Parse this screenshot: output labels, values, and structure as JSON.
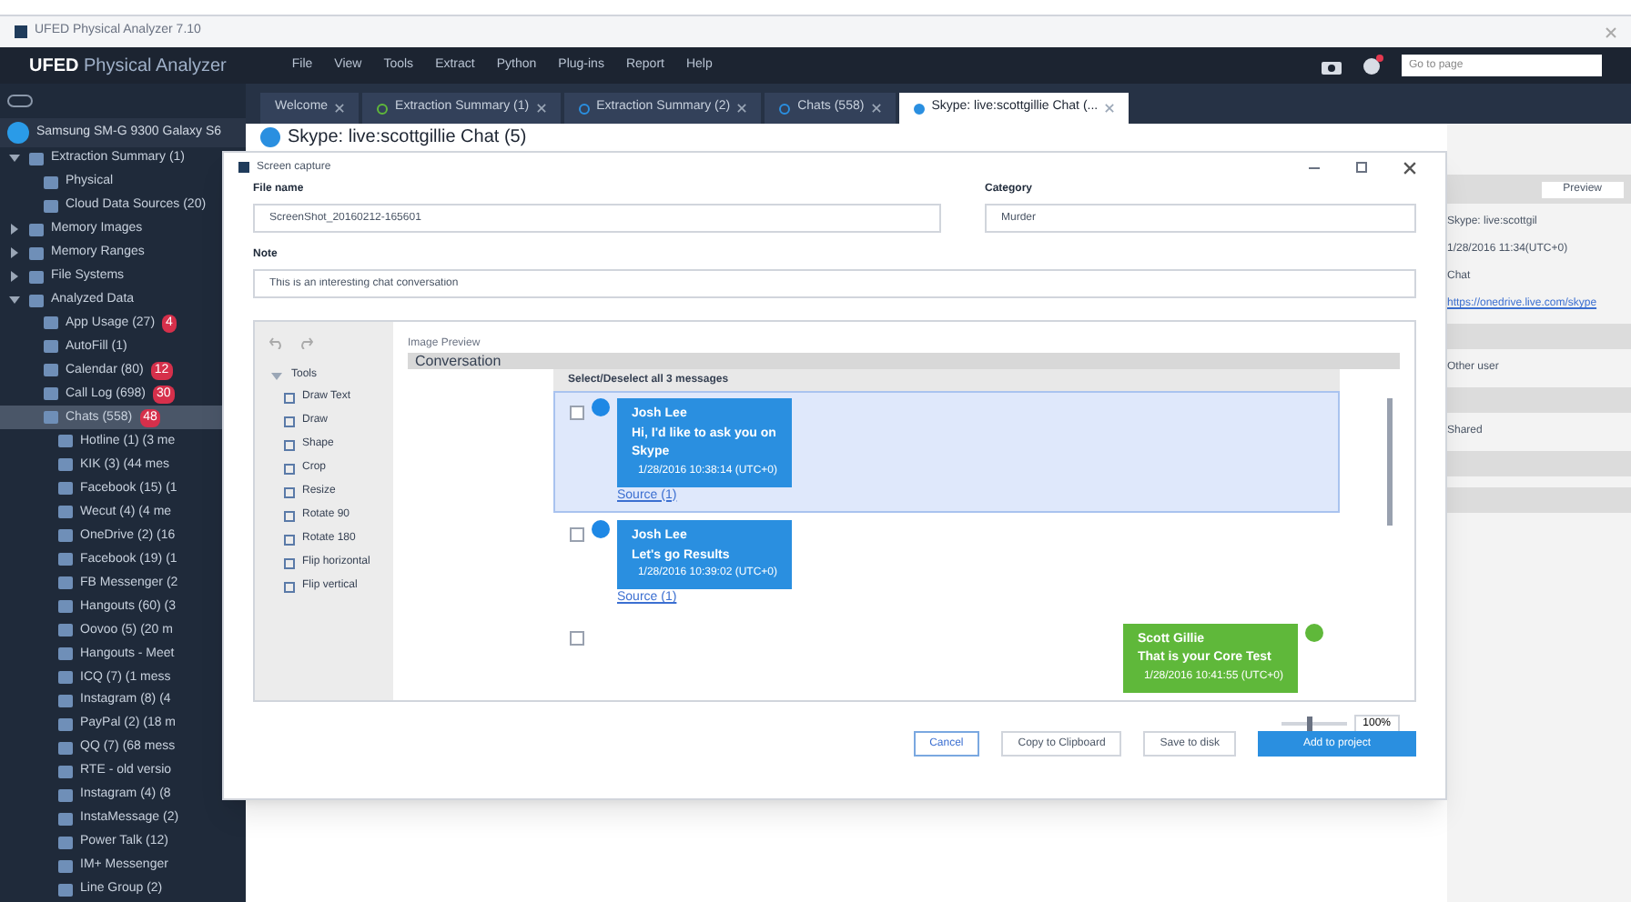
{
  "window": {
    "title": "UFED Physical Analyzer 7.10"
  },
  "app": {
    "brand": "UFED",
    "product": "Physical Analyzer",
    "menu": [
      "File",
      "View",
      "Tools",
      "Extract",
      "Python",
      "Plug-ins",
      "Report",
      "Help"
    ],
    "search": {
      "placeholder": "Go to page"
    }
  },
  "tabs": [
    {
      "label": "Welcome",
      "selected": false,
      "kind": "plain"
    },
    {
      "label": "Extraction Summary (1)",
      "selected": false,
      "kind": "green"
    },
    {
      "label": "Extraction Summary (2)",
      "selected": false,
      "kind": "blue"
    },
    {
      "label": "Chats (558)",
      "selected": false,
      "kind": "blue"
    },
    {
      "label": "Skype: live:scottgillie Chat (...",
      "selected": true,
      "kind": "dot"
    }
  ],
  "sidebar": {
    "device": "Samsung SM-G 9300 Galaxy S6",
    "items": [
      {
        "label": "Extraction Summary (1)",
        "expanded": true,
        "children": [
          {
            "label": "Physical"
          },
          {
            "label": "Cloud Data Sources (20)"
          }
        ]
      },
      {
        "label": "Memory Images",
        "expanded": false
      },
      {
        "label": "Memory Ranges",
        "expanded": false
      },
      {
        "label": "File Systems",
        "expanded": false
      },
      {
        "label": "Analyzed Data",
        "expanded": true,
        "children": [
          {
            "label": "App Usage (27)",
            "badge": "4"
          },
          {
            "label": "AutoFill (1)"
          },
          {
            "label": "Calendar (80)",
            "badge": "12"
          },
          {
            "label": "Call Log (698)",
            "badge": "30"
          },
          {
            "label": "Chats (558)",
            "badge": "48",
            "selected": true,
            "children": [
              {
                "label": "Hotline (1) (3 me"
              },
              {
                "label": "KIK (3) (44 mes"
              },
              {
                "label": "Facebook (15) (1"
              },
              {
                "label": "Wecut (4) (4 me"
              },
              {
                "label": "OneDrive (2) (16"
              },
              {
                "label": "Facebook (19) (1"
              },
              {
                "label": "FB Messenger (2"
              },
              {
                "label": "Hangouts (60) (3"
              },
              {
                "label": "Oovoo (5) (20 m"
              },
              {
                "label": "Hangouts - Meet"
              },
              {
                "label": "ICQ (7) (1 mess"
              },
              {
                "label": "Instagram (8) (4"
              },
              {
                "label": "PayPal (2) (18 m"
              },
              {
                "label": "QQ (7) (68 mess"
              },
              {
                "label": "RTE - old versio"
              },
              {
                "label": "Instagram (4) (8"
              },
              {
                "label": "InstaMessage (2)"
              },
              {
                "label": "Power Talk (12)"
              },
              {
                "label": "IM+ Messenger"
              },
              {
                "label": "Line Group (2)"
              }
            ]
          }
        ]
      }
    ]
  },
  "page": {
    "heading": "Skype: live:scottgillie Chat (5)",
    "side": {
      "button": "Preview",
      "lines": [
        "Skype: live:scottgil",
        "1/28/2016 11:34(UTC+0)",
        "Chat"
      ],
      "link": "https://onedrive.live.com/skype",
      "rows": [
        "Other user",
        "Shared"
      ]
    }
  },
  "dialog": {
    "title": "Screen capture",
    "fields": [
      {
        "label": "File name",
        "value": "ScreenShot_20160212-165601"
      },
      {
        "label": "Category",
        "value": "Murder"
      },
      {
        "label": "Note",
        "value": "This is an interesting chat conversation"
      }
    ],
    "tools": {
      "title": "Tools",
      "expanded": true,
      "items": [
        "Draw Text",
        "Draw",
        "Shape",
        "Crop",
        "Resize",
        "Rotate 90",
        "Rotate 180",
        "Flip horizontal",
        "Flip vertical"
      ]
    },
    "preview": {
      "label": "Image Preview",
      "header": "Conversation",
      "select_all": "Select/Deselect all 3 messages",
      "messages": [
        {
          "kind": "incoming",
          "selected": true,
          "checked": false,
          "sender": "Josh Lee",
          "text": "Hi, I'd like to ask you on Skype",
          "time": "1/28/2016 10:38:14 (UTC+0)",
          "source": "Source (1)"
        },
        {
          "kind": "incoming",
          "selected": false,
          "checked": false,
          "sender": "Josh Lee",
          "text": "Let's go Results",
          "time": "1/28/2016 10:39:02 (UTC+0)",
          "source": "Source (1)"
        },
        {
          "kind": "outgoing",
          "selected": false,
          "checked": false,
          "sender": "Scott Gillie",
          "text": "That is your Core Test",
          "time": "1/28/2016 10:41:55 (UTC+0)"
        }
      ],
      "zoom": {
        "level": 0.45,
        "value": "100%"
      }
    },
    "buttons": [
      {
        "label": "Cancel",
        "kind": "outline"
      },
      {
        "label": "Copy to Clipboard",
        "kind": "plain"
      },
      {
        "label": "Save to disk",
        "kind": "plain"
      },
      {
        "label": "Add to project",
        "kind": "primary"
      }
    ]
  }
}
